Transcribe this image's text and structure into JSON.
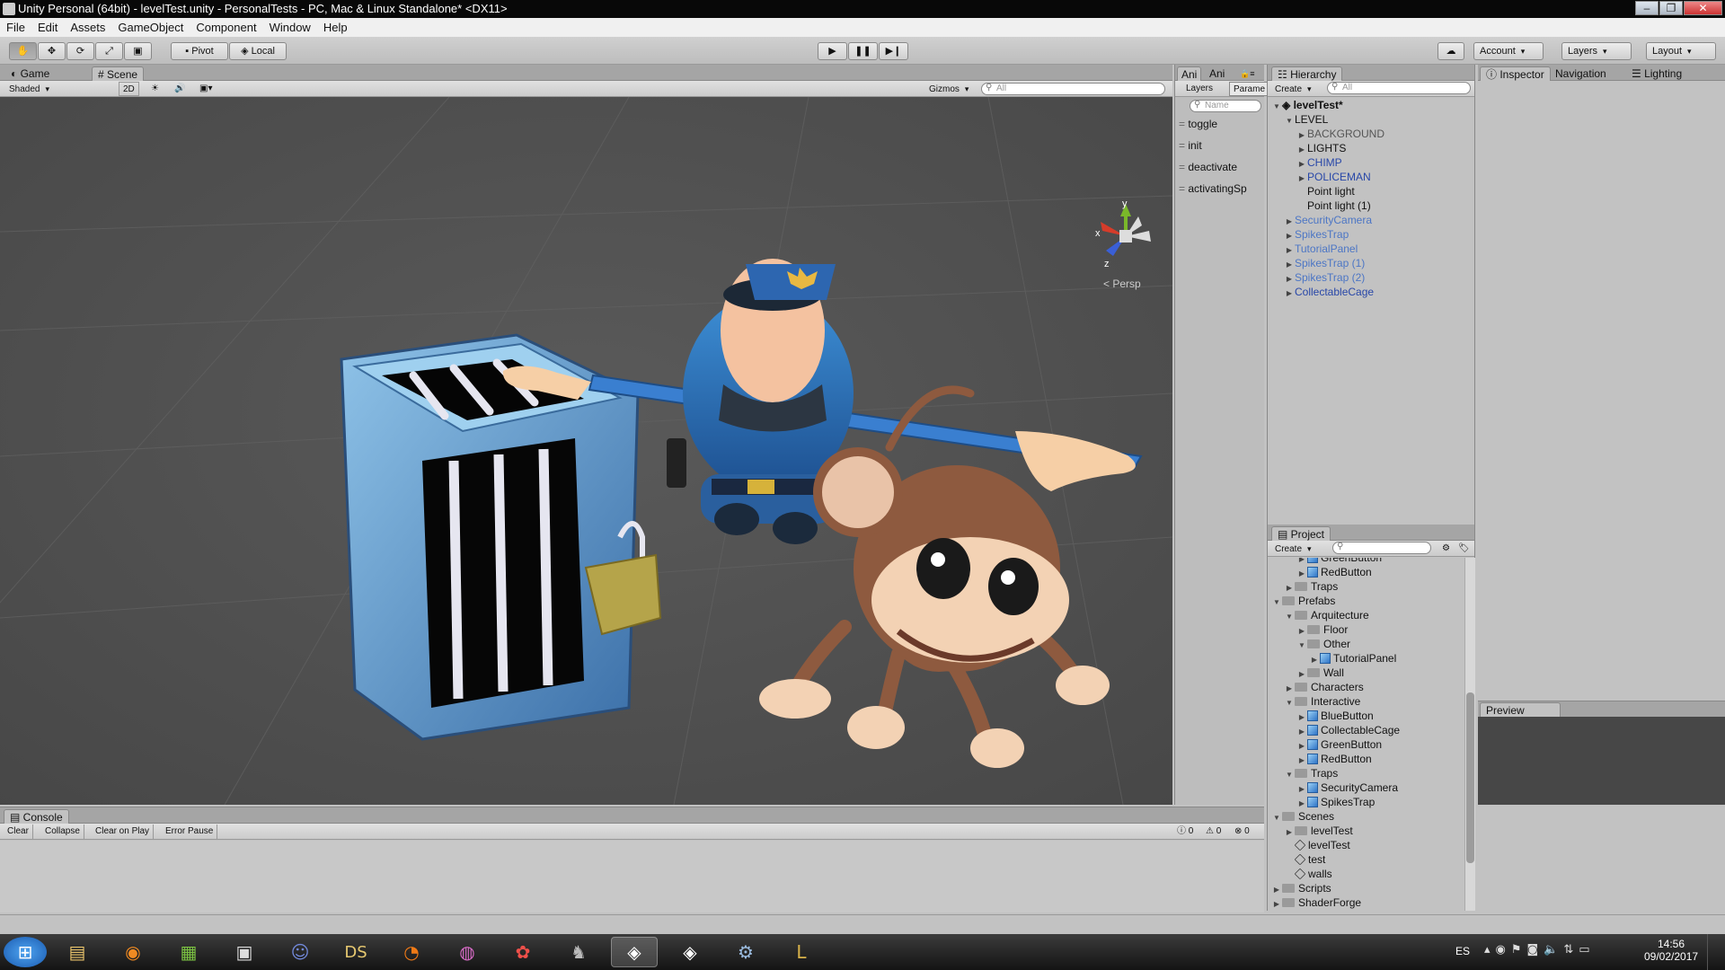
{
  "window": {
    "title": "Unity Personal (64bit) - levelTest.unity - PersonalTests - PC, Mac & Linux Standalone* <DX11>"
  },
  "menu": [
    "File",
    "Edit",
    "Assets",
    "GameObject",
    "Component",
    "Window",
    "Help"
  ],
  "toolbar": {
    "pivot": "Pivot",
    "local": "Local",
    "account": "Account",
    "layers": "Layers",
    "layout": "Layout"
  },
  "scene_panel": {
    "tab_game": "Game",
    "tab_scene": "Scene",
    "shading": "Shaded",
    "mode_2d": "2D",
    "gizmos": "Gizmos",
    "search_placeholder": "All",
    "axis_y": "y",
    "axis_x": "x",
    "axis_z": "z",
    "persp": "Persp"
  },
  "animator_panel": {
    "tab1": "Ani",
    "tab2": "Ani",
    "layers": "Layers",
    "params": "Parame",
    "search_placeholder": "Name",
    "params_list": [
      "toggle",
      "init",
      "deactivate",
      "activatingSp"
    ]
  },
  "hierarchy": {
    "tab": "Hierarchy",
    "create": "Create",
    "search_placeholder": "All",
    "scene": "levelTest*",
    "items": [
      {
        "label": "LEVEL",
        "indent": 1,
        "arrow": "open",
        "style": "normal"
      },
      {
        "label": "BACKGROUND",
        "indent": 2,
        "arrow": "closed",
        "style": "gray"
      },
      {
        "label": "LIGHTS",
        "indent": 2,
        "arrow": "closed",
        "style": "normal"
      },
      {
        "label": "CHIMP",
        "indent": 2,
        "arrow": "closed",
        "style": "prefab"
      },
      {
        "label": "POLICEMAN",
        "indent": 2,
        "arrow": "closed",
        "style": "prefab"
      },
      {
        "label": "Point light",
        "indent": 2,
        "arrow": "none",
        "style": "normal"
      },
      {
        "label": "Point light (1)",
        "indent": 2,
        "arrow": "none",
        "style": "normal"
      },
      {
        "label": "SecurityCamera",
        "indent": 1,
        "arrow": "closed",
        "style": "prefab-dim"
      },
      {
        "label": "SpikesTrap",
        "indent": 1,
        "arrow": "closed",
        "style": "prefab-dim"
      },
      {
        "label": "TutorialPanel",
        "indent": 1,
        "arrow": "closed",
        "style": "prefab-dim"
      },
      {
        "label": "SpikesTrap (1)",
        "indent": 1,
        "arrow": "closed",
        "style": "prefab-dim"
      },
      {
        "label": "SpikesTrap (2)",
        "indent": 1,
        "arrow": "closed",
        "style": "prefab-dim"
      },
      {
        "label": "CollectableCage",
        "indent": 1,
        "arrow": "closed",
        "style": "prefab"
      }
    ]
  },
  "inspector": {
    "tab_inspector": "Inspector",
    "tab_navigation": "Navigation",
    "tab_lighting": "Lighting",
    "preview": "Preview"
  },
  "project": {
    "tab": "Project",
    "create": "Create",
    "items": [
      {
        "label": "GreenButton",
        "indent": 2,
        "arrow": "closed",
        "icon": "cube"
      },
      {
        "label": "RedButton",
        "indent": 2,
        "arrow": "closed",
        "icon": "cube"
      },
      {
        "label": "Traps",
        "indent": 1,
        "arrow": "closed",
        "icon": "folder"
      },
      {
        "label": "Prefabs",
        "indent": 0,
        "arrow": "open",
        "icon": "folder"
      },
      {
        "label": "Arquitecture",
        "indent": 1,
        "arrow": "open",
        "icon": "folder"
      },
      {
        "label": "Floor",
        "indent": 2,
        "arrow": "closed",
        "icon": "folder"
      },
      {
        "label": "Other",
        "indent": 2,
        "arrow": "open",
        "icon": "folder"
      },
      {
        "label": "TutorialPanel",
        "indent": 3,
        "arrow": "closed",
        "icon": "cube"
      },
      {
        "label": "Wall",
        "indent": 2,
        "arrow": "closed",
        "icon": "folder"
      },
      {
        "label": "Characters",
        "indent": 1,
        "arrow": "closed",
        "icon": "folder"
      },
      {
        "label": "Interactive",
        "indent": 1,
        "arrow": "open",
        "icon": "folder"
      },
      {
        "label": "BlueButton",
        "indent": 2,
        "arrow": "closed",
        "icon": "cube"
      },
      {
        "label": "CollectableCage",
        "indent": 2,
        "arrow": "closed",
        "icon": "cube"
      },
      {
        "label": "GreenButton",
        "indent": 2,
        "arrow": "closed",
        "icon": "cube"
      },
      {
        "label": "RedButton",
        "indent": 2,
        "arrow": "closed",
        "icon": "cube"
      },
      {
        "label": "Traps",
        "indent": 1,
        "arrow": "open",
        "icon": "folder"
      },
      {
        "label": "SecurityCamera",
        "indent": 2,
        "arrow": "closed",
        "icon": "cube"
      },
      {
        "label": "SpikesTrap",
        "indent": 2,
        "arrow": "closed",
        "icon": "cube"
      },
      {
        "label": "Scenes",
        "indent": 0,
        "arrow": "open",
        "icon": "folder"
      },
      {
        "label": "levelTest",
        "indent": 1,
        "arrow": "closed",
        "icon": "folder"
      },
      {
        "label": "levelTest",
        "indent": 1,
        "arrow": "none",
        "icon": "unity"
      },
      {
        "label": "test",
        "indent": 1,
        "arrow": "none",
        "icon": "unity"
      },
      {
        "label": "walls",
        "indent": 1,
        "arrow": "none",
        "icon": "unity"
      },
      {
        "label": "Scripts",
        "indent": 0,
        "arrow": "closed",
        "icon": "folder"
      },
      {
        "label": "ShaderForge",
        "indent": 0,
        "arrow": "closed",
        "icon": "folder"
      }
    ]
  },
  "console": {
    "tab": "Console",
    "clear": "Clear",
    "collapse": "Collapse",
    "clear_on_play": "Clear on Play",
    "error_pause": "Error Pause",
    "info_count": "0",
    "warn_count": "0",
    "error_count": "0"
  },
  "taskbar": {
    "apps": [
      "windows-start",
      "file-explorer",
      "firefox",
      "spreadsheet",
      "network",
      "discord",
      "ds",
      "blender",
      "krita",
      "photos",
      "gimp",
      "unity-active",
      "unity",
      "steam",
      "league"
    ],
    "ds_label": "DS",
    "lang": "ES",
    "time": "14:56",
    "date": "09/02/2017"
  }
}
